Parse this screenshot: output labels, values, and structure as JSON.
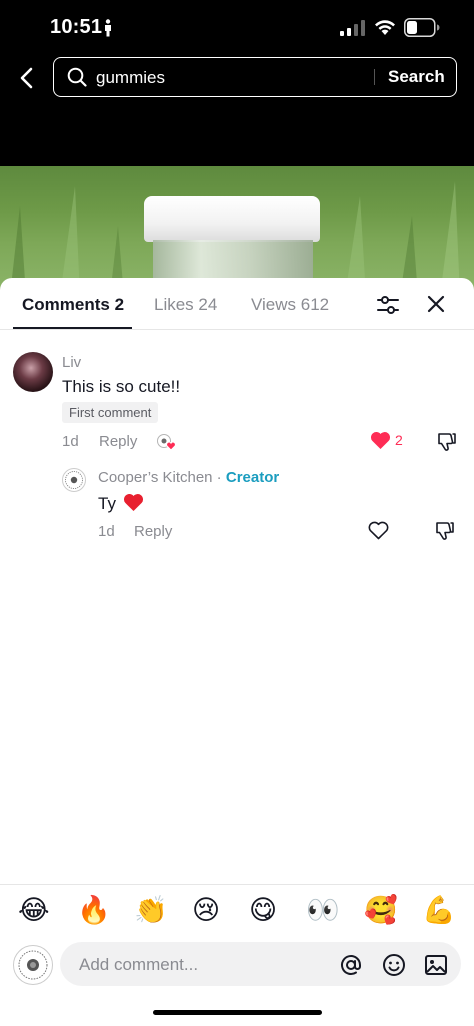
{
  "status_bar": {
    "time": "10:51"
  },
  "search": {
    "query": "gummies",
    "button_label": "Search"
  },
  "tabs": [
    {
      "label": "Comments 2"
    },
    {
      "label": "Likes 24"
    },
    {
      "label": "Views 612"
    }
  ],
  "comments": [
    {
      "username": "Liv",
      "text": "This is so cute!!",
      "badge": "First comment",
      "time": "1d",
      "reply_label": "Reply",
      "like_count": "2",
      "liked": true
    },
    {
      "username": "Cooper’s Kitchen",
      "separator": " · ",
      "creator_tag": "Creator",
      "text": "Ty",
      "time": "1d",
      "reply_label": "Reply",
      "liked": false
    }
  ],
  "emoji_bar": [
    "😂",
    "🔥",
    "👏",
    "😢",
    "😋",
    "👀",
    "🥰",
    "💪"
  ],
  "comment_input": {
    "placeholder": "Add comment..."
  },
  "colors": {
    "accent_like": "#fe2c55",
    "creator": "#1b9dbf",
    "text": "#161823",
    "muted": "#8a8b91"
  }
}
